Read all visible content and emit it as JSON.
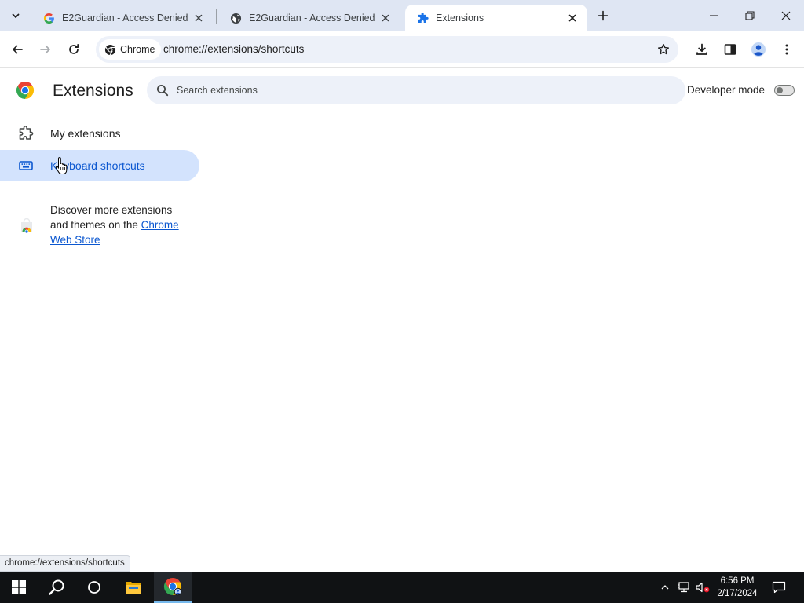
{
  "browser": {
    "tabs": [
      {
        "title": "E2Guardian - Access Denied",
        "favicon": "google-g-icon",
        "active": false
      },
      {
        "title": "E2Guardian - Access Denied",
        "favicon": "globe-icon",
        "active": false
      },
      {
        "title": "Extensions",
        "favicon": "puzzle-icon",
        "active": true
      }
    ],
    "omnibox": {
      "chip_label": "Chrome",
      "url": "chrome://extensions/shortcuts"
    }
  },
  "extensions": {
    "title": "Extensions",
    "search_placeholder": "Search extensions",
    "developer_mode_label": "Developer mode",
    "developer_mode_on": false,
    "sidebar": {
      "items": [
        {
          "label": "My extensions",
          "icon": "puzzle-icon",
          "selected": false
        },
        {
          "label": "Keyboard shortcuts",
          "icon": "keyboard-icon",
          "selected": true
        }
      ],
      "store_promo": {
        "text": "Discover more extensions and themes on the",
        "link_text": "Chrome Web Store"
      }
    }
  },
  "status_url": "chrome://extensions/shortcuts",
  "taskbar": {
    "time": "6:56 PM",
    "date": "2/17/2024"
  },
  "colors": {
    "tabstrip_bg": "#dfe6f3",
    "accent_blue": "#0b57d0",
    "selected_bg": "#d3e3fd",
    "taskbar_bg": "#101214"
  }
}
